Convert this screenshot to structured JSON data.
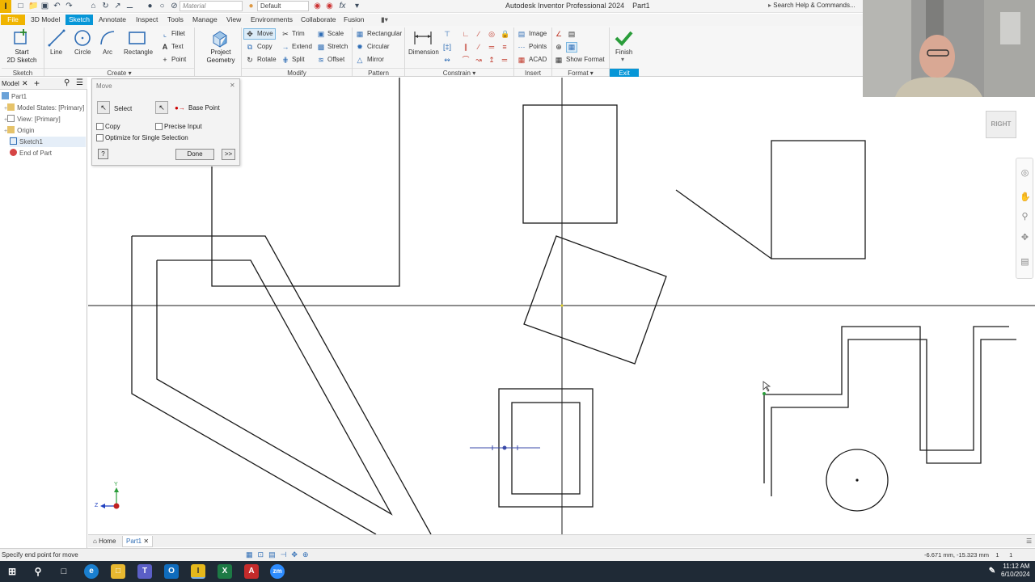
{
  "app": {
    "logo_letter": "I",
    "window_title": "Autodesk Inventor Professional 2024",
    "document_name": "Part1",
    "material_placeholder": "Material",
    "appearance_value": "Default",
    "search_placeholder": "Search Help & Commands..."
  },
  "ribbon_tabs": [
    "File",
    "3D Model",
    "Sketch",
    "Annotate",
    "Inspect",
    "Tools",
    "Manage",
    "View",
    "Environments",
    "Collaborate",
    "Fusion"
  ],
  "ribbon": {
    "sketch_panel": {
      "start_label_1": "Start",
      "start_label_2": "2D Sketch",
      "title": "Sketch"
    },
    "create_panel": {
      "line": "Line",
      "circle": "Circle",
      "arc": "Arc",
      "rectangle": "Rectangle",
      "fillet": "Fillet",
      "text": "Text",
      "point": "Point",
      "title": "Create"
    },
    "project": {
      "label_1": "Project",
      "label_2": "Geometry"
    },
    "modify_panel": {
      "move": "Move",
      "copy": "Copy",
      "rotate": "Rotate",
      "trim": "Trim",
      "extend": "Extend",
      "split": "Split",
      "scale": "Scale",
      "stretch": "Stretch",
      "offset": "Offset",
      "title": "Modify"
    },
    "pattern_panel": {
      "rectangular": "Rectangular",
      "circular": "Circular",
      "mirror": "Mirror",
      "title": "Pattern"
    },
    "constrain_panel": {
      "dimension": "Dimension",
      "title": "Constrain"
    },
    "insert_panel": {
      "image": "Image",
      "points": "Points",
      "acad": "ACAD",
      "title": "Insert"
    },
    "format_panel": {
      "show_format": "Show Format",
      "title": "Format"
    },
    "exit_panel": {
      "finish": "Finish",
      "title": "Exit"
    }
  },
  "browser": {
    "tab_label": "Model",
    "items": [
      "Part1",
      "Model States: [Primary]",
      "View: [Primary]",
      "Origin",
      "Sketch1",
      "End of Part"
    ]
  },
  "move_dialog": {
    "title": "Move",
    "select_label": "Select",
    "base_point_label": "Base Point",
    "copy_label": "Copy",
    "precise_input_label": "Precise Input",
    "optimize_label": "Optimize for Single Selection",
    "done_label": "Done",
    "more_label": ">>",
    "help_label": "?",
    "copy_checked": false,
    "precise_checked": false,
    "optimize_checked": false
  },
  "viewcube_label": "RIGHT",
  "triad": {
    "y": "Y",
    "z": "Z"
  },
  "doc_tabs": {
    "home": "Home",
    "part": "Part1"
  },
  "status": {
    "message": "Specify end point for move",
    "coords": "-6.671 mm, -15.323 mm",
    "count_1": "1",
    "count_2": "1"
  },
  "taskbar": {
    "time": "11:12 AM",
    "date": "6/10/2024"
  },
  "colors": {
    "accent": "#0696d7",
    "file_tab": "#f0b400",
    "taskbar": "#1f2a36"
  }
}
